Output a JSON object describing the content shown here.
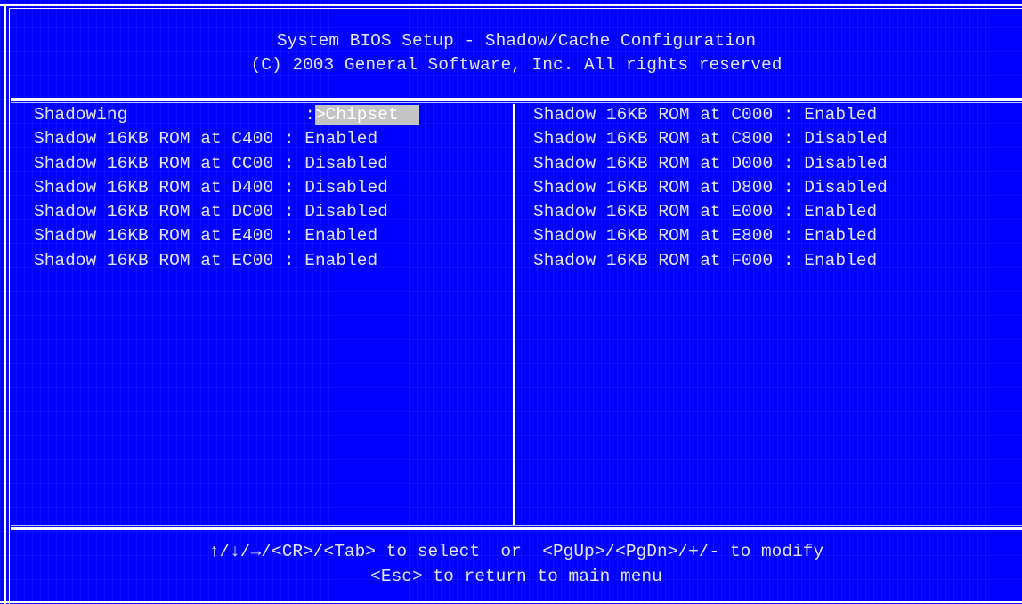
{
  "header": {
    "title": "System BIOS Setup - Shadow/Cache Configuration",
    "copyright": "(C) 2003 General Software, Inc. All rights reserved"
  },
  "left_items": [
    {
      "label": "Shadowing                 ",
      "sep": ":",
      "value": ">Chipset  ",
      "selected": true
    },
    {
      "label": "Shadow 16KB ROM at C400 ",
      "sep": ":",
      "value": " Enabled",
      "selected": false
    },
    {
      "label": "Shadow 16KB ROM at CC00 ",
      "sep": ":",
      "value": " Disabled",
      "selected": false
    },
    {
      "label": "Shadow 16KB ROM at D400 ",
      "sep": ":",
      "value": " Disabled",
      "selected": false
    },
    {
      "label": "Shadow 16KB ROM at DC00 ",
      "sep": ":",
      "value": " Disabled",
      "selected": false
    },
    {
      "label": "Shadow 16KB ROM at E400 ",
      "sep": ":",
      "value": " Enabled",
      "selected": false
    },
    {
      "label": "Shadow 16KB ROM at EC00 ",
      "sep": ":",
      "value": " Enabled",
      "selected": false
    }
  ],
  "right_items": [
    {
      "label": "Shadow 16KB ROM at C000 ",
      "sep": ":",
      "value": " Enabled"
    },
    {
      "label": "Shadow 16KB ROM at C800 ",
      "sep": ":",
      "value": " Disabled"
    },
    {
      "label": "Shadow 16KB ROM at D000 ",
      "sep": ":",
      "value": " Disabled"
    },
    {
      "label": "Shadow 16KB ROM at D800 ",
      "sep": ":",
      "value": " Disabled"
    },
    {
      "label": "Shadow 16KB ROM at E000 ",
      "sep": ":",
      "value": " Enabled"
    },
    {
      "label": "Shadow 16KB ROM at E800 ",
      "sep": ":",
      "value": " Enabled"
    },
    {
      "label": "Shadow 16KB ROM at F000 ",
      "sep": ":",
      "value": " Enabled"
    }
  ],
  "footer": {
    "line1": "↑/↓/→/<CR>/<Tab> to select  or  <PgUp>/<PgDn>/+/- to modify",
    "line2": "<Esc> to return to main menu"
  },
  "colors": {
    "background": "#0000ff",
    "text": "#e4e4f4",
    "highlight": "#c4c4c4",
    "border": "#ffffff"
  }
}
